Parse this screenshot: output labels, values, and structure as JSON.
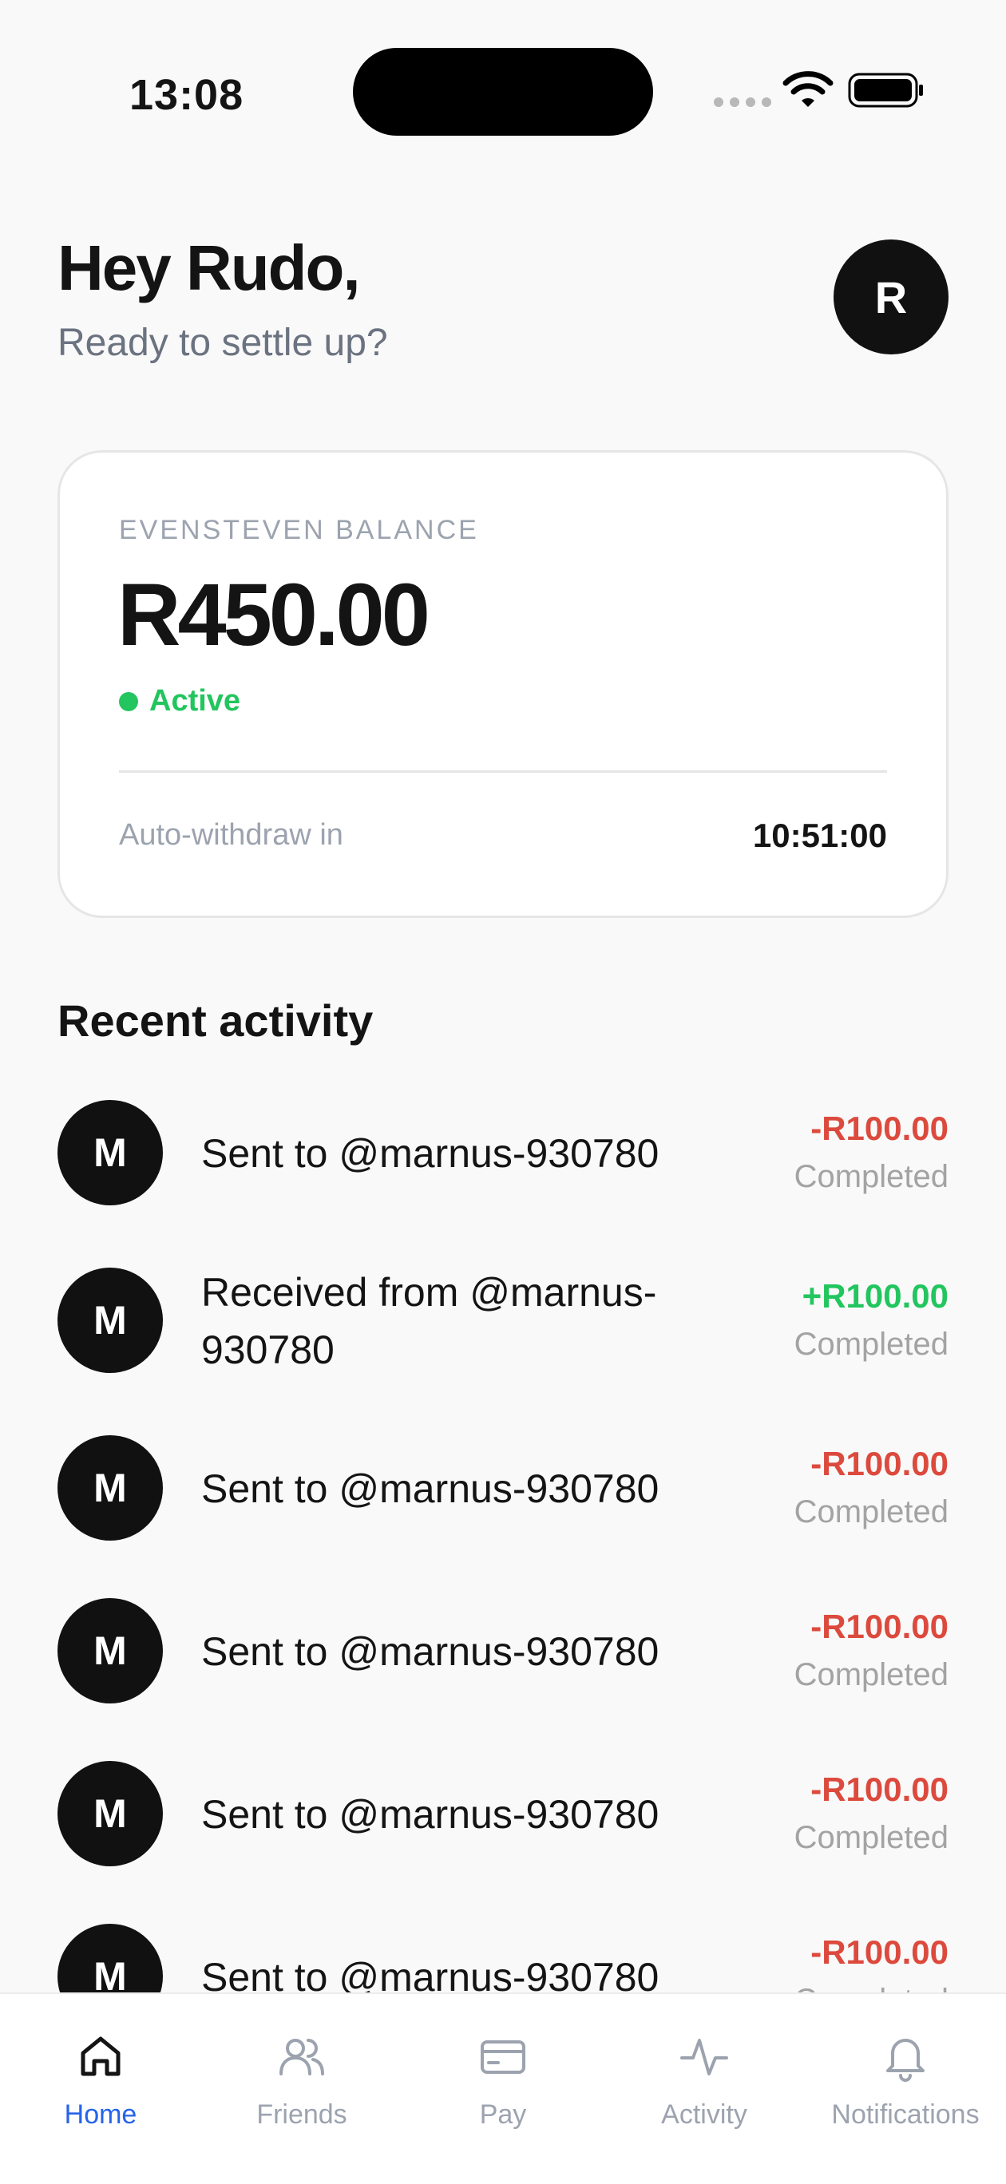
{
  "status_bar": {
    "time": "13:08"
  },
  "header": {
    "greeting": "Hey Rudo,",
    "subtitle": "Ready to settle up?",
    "avatar_initial": "R"
  },
  "balance_card": {
    "label": "EVENSTEVEN BALANCE",
    "amount": "R450.00",
    "status": "Active",
    "withdraw_label": "Auto-withdraw in",
    "withdraw_time": "10:51:00"
  },
  "activity": {
    "title": "Recent activity",
    "items": [
      {
        "initial": "M",
        "description": "Sent to @marnus-930780",
        "amount": "-R100.00",
        "sign": "negative",
        "status": "Completed"
      },
      {
        "initial": "M",
        "description": "Received from @marnus-930780",
        "amount": "+R100.00",
        "sign": "positive",
        "status": "Completed"
      },
      {
        "initial": "M",
        "description": "Sent to @marnus-930780",
        "amount": "-R100.00",
        "sign": "negative",
        "status": "Completed"
      },
      {
        "initial": "M",
        "description": "Sent to @marnus-930780",
        "amount": "-R100.00",
        "sign": "negative",
        "status": "Completed"
      },
      {
        "initial": "M",
        "description": "Sent to @marnus-930780",
        "amount": "-R100.00",
        "sign": "negative",
        "status": "Completed"
      },
      {
        "initial": "M",
        "description": "Sent to @marnus-930780",
        "amount": "-R100.00",
        "sign": "negative",
        "status": "Completed"
      }
    ]
  },
  "nav": {
    "items": [
      {
        "label": "Home",
        "icon": "home-icon",
        "active": true
      },
      {
        "label": "Friends",
        "icon": "friends-icon",
        "active": false
      },
      {
        "label": "Pay",
        "icon": "card-icon",
        "active": false
      },
      {
        "label": "Activity",
        "icon": "activity-icon",
        "active": false
      },
      {
        "label": "Notifications",
        "icon": "bell-icon",
        "active": false
      }
    ]
  },
  "colors": {
    "active_green": "#22c55e",
    "negative_red": "#dc4a3d",
    "nav_active_blue": "#2563eb"
  }
}
